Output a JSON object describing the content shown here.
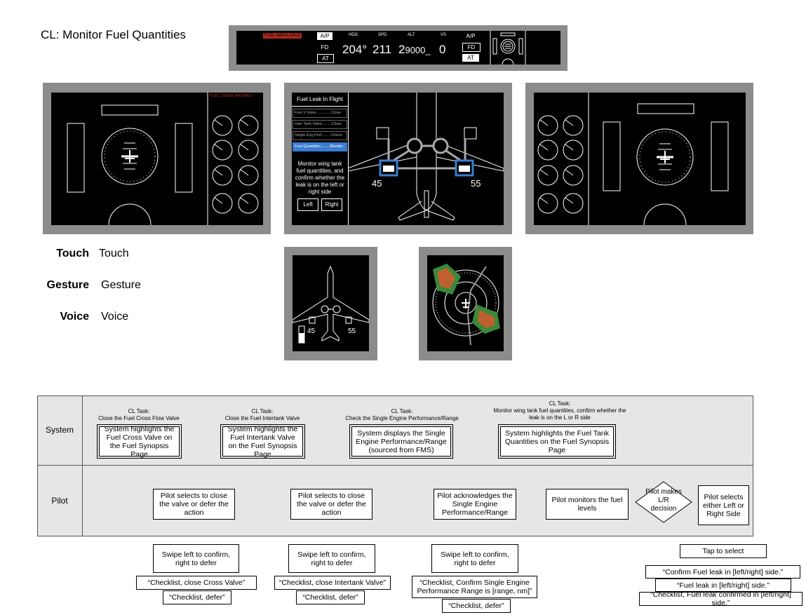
{
  "title": "CL: Monitor Fuel Quantities",
  "top_panel": {
    "alert": "FUEL IMBALANCE",
    "ap": "A/P",
    "fd": "FD",
    "at": "AT",
    "labels": {
      "hdg": "HDG",
      "spd": "SPD",
      "alt": "ALT",
      "vs": "VS"
    },
    "values": {
      "hdg": "204°",
      "spd": "211",
      "alt_big": "2",
      "alt_small": "9000",
      "vs": "0"
    },
    "ap2": "A/P",
    "fd2": "FD",
    "at2": "AT"
  },
  "left_display": {
    "alert": "FUEL USAGE ANOMALY"
  },
  "center_display": {
    "title": "Fuel Leak In Flight",
    "items": [
      {
        "label": "Fuel X Valve..............Close"
      },
      {
        "label": "Inter Tank Valve.........Close"
      },
      {
        "label": "Single Eng Perf.........Check"
      },
      {
        "label": "Fuel Quantities.........Monitor"
      }
    ],
    "prompt": "Monitor wing tank fuel quantities, and confirm whether the leak is on the left or right side",
    "left_btn": "Left",
    "right_btn": "Right",
    "left_qty": "45",
    "right_qty": "55"
  },
  "small_left": {
    "left_qty": "45",
    "right_qty": "55"
  },
  "legend": [
    {
      "key": "Touch",
      "value": "Touch"
    },
    {
      "key": "Gesture",
      "value": "Gesture"
    },
    {
      "key": "Voice",
      "value": "Voice"
    }
  ],
  "flow": {
    "row_system": "System",
    "row_pilot": "Pilot",
    "tasks": [
      {
        "header": "CL Task:\nClose the Fuel Cross Flow Valve",
        "system": "System highlights the Fuel Cross Valve on the Fuel Synopsis Page",
        "pilot": "Pilot selects to close the valve or defer the action",
        "gesture": "Swipe left to confirm, right to defer",
        "voice1": "“Checklist, close Cross Valve”",
        "voice2": "“Checklist, defer”"
      },
      {
        "header": "CL Task:\nClose the Fuel Intertank Valve",
        "system": "System highlights the Fuel Intertank Valve on the Fuel Synopsis Page",
        "pilot": "Pilot selects to close the valve or defer the action",
        "gesture": "Swipe left to confirm, right to defer",
        "voice1": "“Checklist, close Intertank Valve”",
        "voice2": "“Checklist, defer”"
      },
      {
        "header": "CL Task:\nCheck the Single Engine Performance/Range",
        "system": "System displays the Single Engine Performance/Range (sourced from FMS)",
        "pilot": "Pilot acknowledges the Single Engine Performance/Range",
        "gesture": "Swipe left to confirm, right to defer",
        "voice1": "“Checklist, Confirm Single Engine Performance Range is [range, nm]”",
        "voice2": "“Checklist, defer”"
      },
      {
        "header": "CL Task:\nMonitor wing tank fuel quantities, confirm whether the leak is on the L or R side",
        "system": "System highlights the Fuel Tank Quantities on the Fuel Synopsis Page",
        "pilot": "Pilot monitors the fuel levels"
      }
    ],
    "decision": "Pilot makes L/R decision",
    "final_pilot": "Pilot selects either Left or Right Side",
    "touch": "Tap to select",
    "voice_final": [
      "“Confirm Fuel leak in [left/right] side.”",
      "“Fuel leak in [left/right] side.”",
      "“Checklist, Fuel leak confirmed in [left/right] side.”"
    ]
  }
}
